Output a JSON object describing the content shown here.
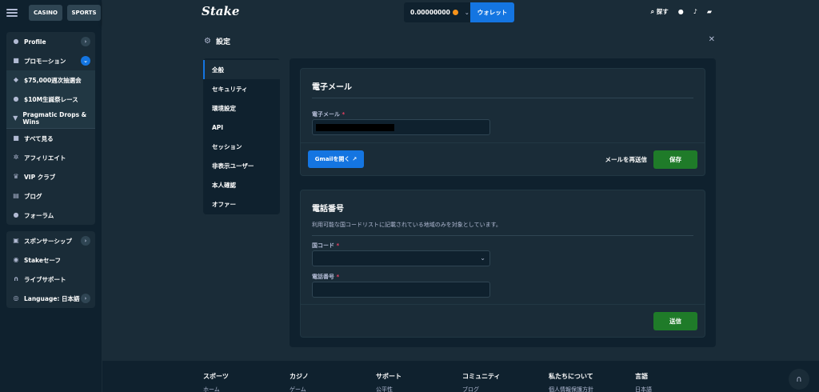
{
  "sidebar": {
    "top": {
      "casino": "CASINO",
      "sports": "SPORTS"
    },
    "items": [
      {
        "label": "Profile",
        "icon": "user-icon"
      },
      {
        "label": "プロモーション",
        "icon": "gift-icon"
      },
      {
        "label": "$75,000週次抽選会",
        "icon": "ticket-icon"
      },
      {
        "label": "$10M生誕祭レース",
        "icon": "coin-icon"
      },
      {
        "label": "Pragmatic Drops & Wins",
        "icon": "trophy-icon"
      },
      {
        "label": "すべて見る",
        "icon": "gift-icon"
      },
      {
        "label": "アフィリエイト",
        "icon": "affiliate-icon"
      },
      {
        "label": "VIP クラブ",
        "icon": "crown-icon"
      },
      {
        "label": "ブログ",
        "icon": "blog-icon"
      },
      {
        "label": "フォーラム",
        "icon": "forum-icon"
      },
      {
        "label": "スポンサーシップ",
        "icon": "sponsor-icon"
      },
      {
        "label": "Stakeセーフ",
        "icon": "shield-icon"
      },
      {
        "label": "ライブサポート",
        "icon": "headset-icon"
      },
      {
        "label": "Language: 日本語",
        "icon": "globe-icon"
      }
    ]
  },
  "header": {
    "logo": "Stake",
    "balance": "0.00000000",
    "wallet": "ウォレット",
    "search": "探す"
  },
  "settings": {
    "title": "設定",
    "nav": [
      "全般",
      "セキュリティ",
      "環境設定",
      "API",
      "セッション",
      "非表示ユーザー",
      "本人確認",
      "オファー"
    ]
  },
  "email_card": {
    "title": "電子メール",
    "email_label": "電子メール",
    "open_gmail": "Gmailを開く",
    "resend": "メールを再送信",
    "save": "保存"
  },
  "phone_card": {
    "title": "電話番号",
    "description": "利用可能な国コードリストに記載されている地域のみを対象としています。",
    "country_code_label": "国コード",
    "phone_label": "電話番号",
    "submit": "送信"
  },
  "footer": {
    "columns": [
      {
        "title": "スポーツ",
        "sub": "ホーム"
      },
      {
        "title": "カジノ",
        "sub": "ゲーム"
      },
      {
        "title": "サポート",
        "sub": "公平性"
      },
      {
        "title": "コミュニティ",
        "sub": "ブログ"
      },
      {
        "title": "私たちについて",
        "sub": "個人情報保護方針"
      },
      {
        "title": "言語",
        "sub": "日本語"
      }
    ]
  },
  "colors": {
    "bg_dark": "#0f212e",
    "bg_panel": "#1a2c38",
    "accent_blue": "#1475e1",
    "accent_green": "#1f7b29",
    "muted_text": "#b1bad3"
  }
}
